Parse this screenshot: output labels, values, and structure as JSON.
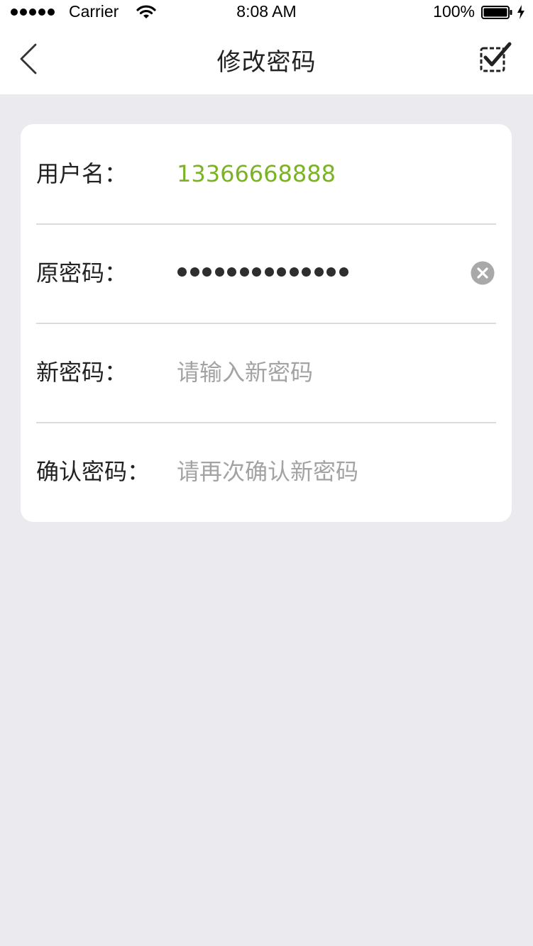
{
  "status_bar": {
    "carrier": "Carrier",
    "time": "8:08 AM",
    "battery_percent": "100%",
    "signal_dots": 5
  },
  "nav": {
    "title": "修改密码",
    "back_icon": "chevron-left-icon",
    "confirm_icon": "checkbox-checked-icon"
  },
  "form": {
    "username": {
      "label": "用户名：",
      "value": "13366668888"
    },
    "old_password": {
      "label": "原密码：",
      "masked_length": 14,
      "clear_icon": "clear-circle-icon"
    },
    "new_password": {
      "label": "新密码：",
      "placeholder": "请输入新密码"
    },
    "confirm_password": {
      "label": "确认密码：",
      "placeholder": "请再次确认新密码"
    }
  },
  "colors": {
    "background": "#ebebef",
    "accent_green": "#7bb325",
    "placeholder": "#a3a3a3",
    "text": "#222222"
  }
}
